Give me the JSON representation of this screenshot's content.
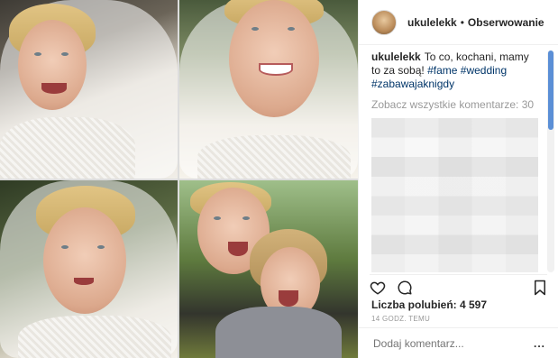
{
  "header": {
    "username": "ukulelekk",
    "separator": "•",
    "follow_label": "Obserwowanie"
  },
  "caption": {
    "username": "ukulelekk",
    "text": "To co, kochani, mamy to za sobą!",
    "tags": [
      "#fame",
      "#wedding",
      "#zabawajaknigdy"
    ]
  },
  "comments": {
    "view_all_label": "Zobacz wszystkie komentarze: 30"
  },
  "actions": {
    "icons": [
      "heart-icon",
      "comment-icon",
      "bookmark-icon"
    ]
  },
  "likes_label": "Liczba polubień: 4 597",
  "timestamp": "14 GODZ. TEMU",
  "add_comment": {
    "placeholder": "Dodaj komentarz...",
    "more_label": "..."
  },
  "colors": {
    "link": "#003569",
    "muted": "#999999",
    "scroll_thumb": "#5b8fd6"
  }
}
